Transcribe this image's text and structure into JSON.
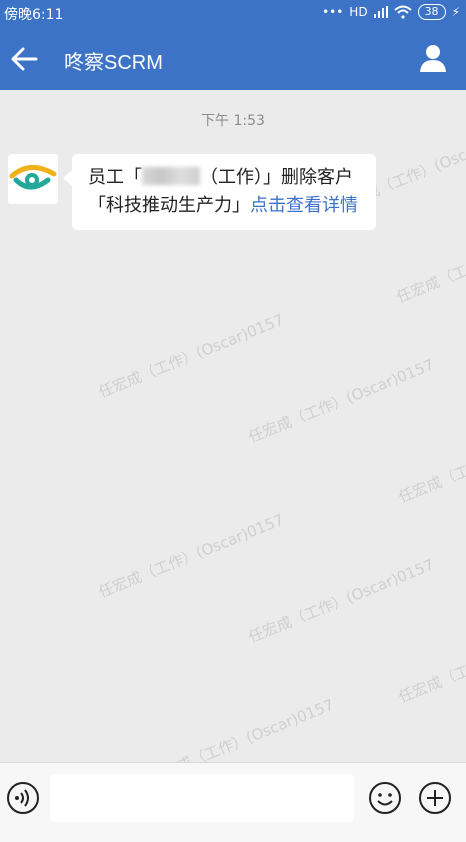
{
  "status_bar": {
    "time": "傍晚6:11",
    "network": "HD",
    "battery": "38"
  },
  "app_bar": {
    "title": "咚察SCRM"
  },
  "chat": {
    "timestamp": "下午 1:53",
    "message": {
      "prefix": "员工「",
      "suffix": "（工作）」删除客户「科技推动生产力」",
      "link_text": "点击查看详情"
    },
    "watermark_text": "任宏成（工作）(Oscar)0157"
  },
  "input": {
    "placeholder": ""
  },
  "colors": {
    "accent": "#3d73c7",
    "brand_eye_orange": "#f0b21b",
    "brand_eye_teal": "#22a89a"
  }
}
